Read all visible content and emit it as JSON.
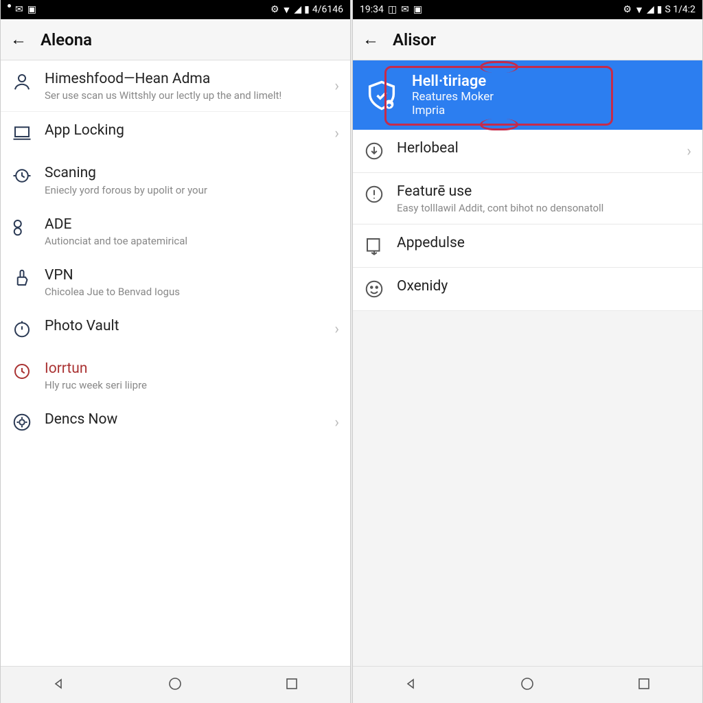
{
  "left": {
    "statusbar": {
      "left_icons": [
        "circle",
        "mail",
        "note"
      ],
      "right_text": "4/6146"
    },
    "title": "Aleona",
    "items": [
      {
        "icon": "user",
        "title": "Himeshfood—Hean Adma",
        "sub": "Ser use scan us Wittshly our lectly up the and limelt!",
        "chev": true
      },
      {
        "icon": "laptop",
        "title": "App Locking",
        "chev": true
      },
      {
        "icon": "clock-scan",
        "title": "Scaning",
        "sub": "Eniecly yord forous by upolit or your"
      },
      {
        "icon": "glasses",
        "title": "ADE",
        "sub": "Autionciat and toe apatemirical"
      },
      {
        "icon": "thumb",
        "title": "VPN",
        "sub": "Chicolea Jue to Benvad Iogus"
      },
      {
        "icon": "timer",
        "title": "Photo Vault",
        "chev": true
      },
      {
        "icon": "clock-red",
        "title": "Iorrtun",
        "sub": "Hly ruc week seri liipre",
        "red": true
      },
      {
        "icon": "gear-circle",
        "title": "Dencs Now",
        "chev": true
      }
    ]
  },
  "right": {
    "statusbar": {
      "time": "19:34",
      "left_icons": [
        "sig",
        "mail",
        "note"
      ],
      "right_text": "S 1/4:2"
    },
    "title": "Alisor",
    "banner": {
      "title": "Hell·tiriage",
      "sub1": "Reatures Moker",
      "sub2": "Impria"
    },
    "items": [
      {
        "icon": "down-circle",
        "title": "Herlobeal",
        "chev": true
      },
      {
        "icon": "alert-circle",
        "title": "Featurē use",
        "sub": "Easy tolllawil Addit, cont bihot no densonatoll"
      },
      {
        "icon": "export",
        "title": "Appedulse"
      },
      {
        "icon": "emoji",
        "title": "Oxenidy"
      }
    ]
  },
  "colors": {
    "accent": "#2c7ef0",
    "highlight": "#c62b4a",
    "danger": "#a33"
  }
}
